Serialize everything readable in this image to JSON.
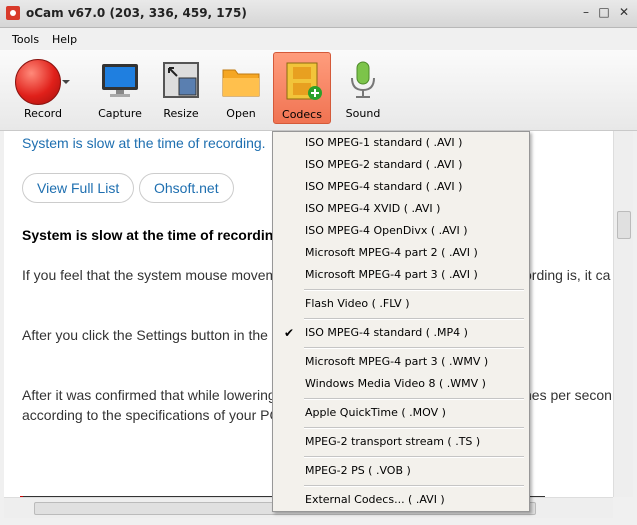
{
  "window": {
    "title": "oCam v67.0 (203, 336, 459, 175)",
    "minimize": "–",
    "maximize": "□",
    "close": "✕"
  },
  "menu": [
    "Tools",
    "Help"
  ],
  "toolbar": {
    "buttons": [
      "Record",
      "Capture",
      "Resize",
      "Open",
      "Codecs",
      "Sound"
    ]
  },
  "content": {
    "heading_link": "System is slow at the time of recording.",
    "buttons": [
      "View Full List",
      "Ohsoft.net"
    ],
    "section_title": "System is slow at the time of recordin",
    "para1_left": "If you feel that the system mouse movem",
    "para1_right": "ording is, it ca",
    "para2": "After you click the Settings button in the (",
    "para3_left": "After it was confirmed that while lowering",
    "para3_right": "nes per secon",
    "para4": "according to the specifications of your PC"
  },
  "dropdown": {
    "items": [
      "ISO MPEG-1 standard ( .AVI )",
      "ISO MPEG-2 standard ( .AVI )",
      "ISO MPEG-4 standard ( .AVI )",
      "ISO MPEG-4 XVID ( .AVI )",
      "ISO MPEG-4 OpenDivx ( .AVI )",
      "Microsoft MPEG-4 part 2 ( .AVI )",
      "Microsoft MPEG-4 part 3 ( .AVI )",
      "Flash Video ( .FLV )",
      "ISO MPEG-4 standard ( .MP4 )",
      "Microsoft MPEG-4 part 3 ( .WMV )",
      "Windows Media Video 8 ( .WMV )",
      "Apple QuickTime ( .MOV )",
      "MPEG-2 transport stream ( .TS )",
      "MPEG-2 PS ( .VOB )",
      "External Codecs... ( .AVI )"
    ],
    "checked_index": 8,
    "check_mark": "✔"
  },
  "colors": {
    "link_blue": "#1e6fb0",
    "active_tab": "#f07352"
  }
}
